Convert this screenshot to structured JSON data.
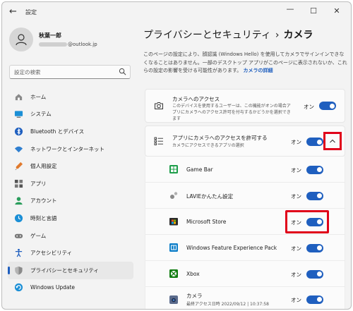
{
  "window": {
    "title": "設定",
    "minimize": "—",
    "maximize": "☐",
    "close": "✕"
  },
  "profile": {
    "name": "秋葉一郎",
    "email_visible": "@outlook.jp"
  },
  "search": {
    "placeholder": "設定の検索"
  },
  "nav": {
    "items": [
      {
        "label": "ホーム",
        "icon": "home-icon"
      },
      {
        "label": "システム",
        "icon": "system-icon"
      },
      {
        "label": "Bluetooth とデバイス",
        "icon": "bluetooth-icon"
      },
      {
        "label": "ネットワークとインターネット",
        "icon": "network-icon"
      },
      {
        "label": "個人用設定",
        "icon": "personalization-icon"
      },
      {
        "label": "アプリ",
        "icon": "apps-icon"
      },
      {
        "label": "アカウント",
        "icon": "accounts-icon"
      },
      {
        "label": "時刻と言語",
        "icon": "time-language-icon"
      },
      {
        "label": "ゲーム",
        "icon": "gaming-icon"
      },
      {
        "label": "アクセシビリティ",
        "icon": "accessibility-icon"
      },
      {
        "label": "プライバシーとセキュリティ",
        "icon": "privacy-shield-icon",
        "active": true
      },
      {
        "label": "Windows Update",
        "icon": "windows-update-icon"
      }
    ]
  },
  "breadcrumb": {
    "parent": "プライバシーとセキュリティ",
    "separator": "›",
    "current": "カメラ"
  },
  "description": {
    "text": "このページの設定により、顔認識 (Windows Hello) を使用してカメラでサインインできなくなることはありません。一部のデスクトップ アプリがこのページに表示されないか、これらの設定の影響を受ける可能性があります。",
    "link": "カメラの詳細"
  },
  "camera_access": {
    "title": "カメラへのアクセス",
    "subtitle": "このデバイスを使用するユーザーは、この機能がオンの場合アプリにカメラへのアクセス許可を付与するかどうかを選択できます",
    "state_label": "オン",
    "on": true
  },
  "app_access": {
    "title": "アプリにカメラへのアクセスを許可する",
    "subtitle": "カメラにアクセスできるアプリの選択",
    "state_label": "オン",
    "on": true,
    "expanded": true
  },
  "apps": [
    {
      "name": "Game Bar",
      "sub": "",
      "state_label": "オン",
      "on": true,
      "icon": "game-bar-icon"
    },
    {
      "name": "LAVIEかんたん設定",
      "sub": "",
      "state_label": "オン",
      "on": true,
      "icon": "lavie-settings-icon"
    },
    {
      "name": "Microsoft Store",
      "sub": "",
      "state_label": "オン",
      "on": true,
      "icon": "microsoft-store-icon",
      "highlighted": true
    },
    {
      "name": "Windows Feature Experience Pack",
      "sub": "",
      "state_label": "オン",
      "on": true,
      "icon": "feature-pack-icon"
    },
    {
      "name": "Xbox",
      "sub": "",
      "state_label": "オン",
      "on": true,
      "icon": "xbox-icon"
    },
    {
      "name": "カメラ",
      "sub": "最終アクセス日時 2022/09/12 | 10:37:58",
      "state_label": "オン",
      "on": true,
      "icon": "camera-app-icon"
    }
  ],
  "colors": {
    "accent": "#1f5fbf",
    "highlight": "#e0001a",
    "background": "#f3f3f3",
    "card": "#fbfbfb"
  }
}
